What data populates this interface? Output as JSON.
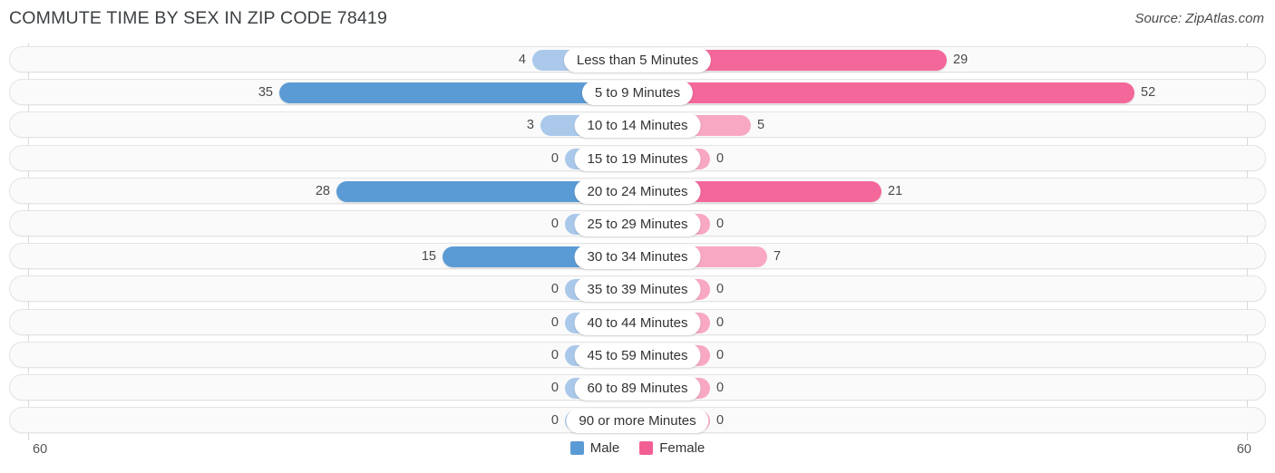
{
  "header": {
    "title": "COMMUTE TIME BY SEX IN ZIP CODE 78419",
    "source": "Source: ZipAtlas.com"
  },
  "legend": {
    "items": [
      {
        "label": "Male",
        "color": "#5b9bd5",
        "icon": "legend-swatch"
      },
      {
        "label": "Female",
        "color": "#f25f95",
        "icon": "legend-swatch"
      }
    ]
  },
  "axis": {
    "left_tick": "60",
    "right_tick": "60",
    "max": 60
  },
  "colors": {
    "male_strong": "#5b9bd5",
    "male_light": "#aac8ea",
    "female_strong": "#f4679a",
    "female_light": "#f8a8c3",
    "track": "#fafafa",
    "track_border": "#e4e4e4"
  },
  "chart_data": {
    "type": "bar",
    "title": "COMMUTE TIME BY SEX IN ZIP CODE 78419",
    "subtitle": "Source: ZipAtlas.com",
    "orientation": "horizontal-diverging",
    "xlabel": "",
    "ylabel": "",
    "xlim": [
      0,
      60
    ],
    "grid": false,
    "legend_position": "bottom-center",
    "categories": [
      "Less than 5 Minutes",
      "5 to 9 Minutes",
      "10 to 14 Minutes",
      "15 to 19 Minutes",
      "20 to 24 Minutes",
      "25 to 29 Minutes",
      "30 to 34 Minutes",
      "35 to 39 Minutes",
      "40 to 44 Minutes",
      "45 to 59 Minutes",
      "60 to 89 Minutes",
      "90 or more Minutes"
    ],
    "series": [
      {
        "name": "Male",
        "values": [
          4,
          35,
          3,
          0,
          28,
          0,
          15,
          0,
          0,
          0,
          0,
          0
        ]
      },
      {
        "name": "Female",
        "values": [
          29,
          52,
          5,
          0,
          21,
          0,
          7,
          0,
          0,
          0,
          0,
          0
        ]
      }
    ]
  },
  "rows": [
    {
      "category": "Less than 5 Minutes",
      "male": "4",
      "female": "29"
    },
    {
      "category": "5 to 9 Minutes",
      "male": "35",
      "female": "52"
    },
    {
      "category": "10 to 14 Minutes",
      "male": "3",
      "female": "5"
    },
    {
      "category": "15 to 19 Minutes",
      "male": "0",
      "female": "0"
    },
    {
      "category": "20 to 24 Minutes",
      "male": "28",
      "female": "21"
    },
    {
      "category": "25 to 29 Minutes",
      "male": "0",
      "female": "0"
    },
    {
      "category": "30 to 34 Minutes",
      "male": "15",
      "female": "7"
    },
    {
      "category": "35 to 39 Minutes",
      "male": "0",
      "female": "0"
    },
    {
      "category": "40 to 44 Minutes",
      "male": "0",
      "female": "0"
    },
    {
      "category": "45 to 59 Minutes",
      "male": "0",
      "female": "0"
    },
    {
      "category": "60 to 89 Minutes",
      "male": "0",
      "female": "0"
    },
    {
      "category": "90 or more Minutes",
      "male": "0",
      "female": "0"
    }
  ]
}
